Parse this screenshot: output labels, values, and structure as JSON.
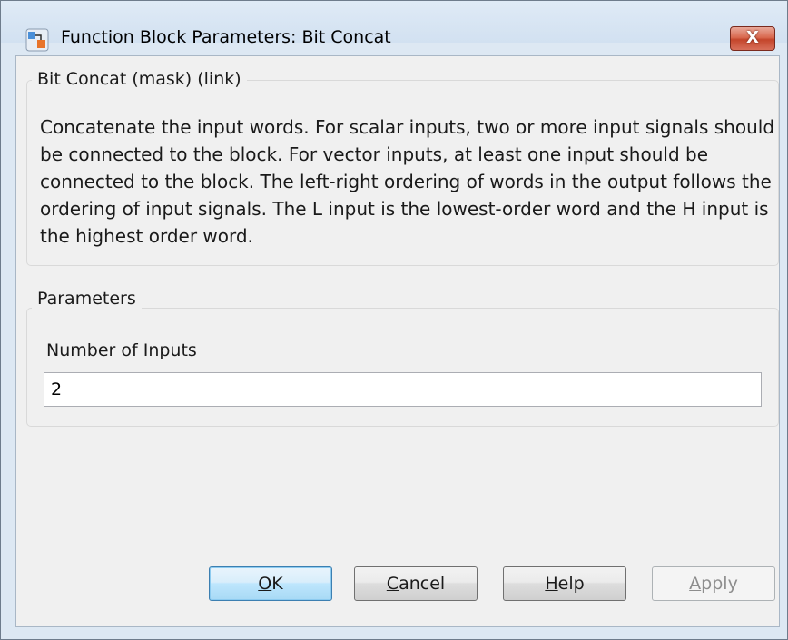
{
  "window": {
    "title": "Function Block Parameters: Bit Concat",
    "app_icon": "simulink-block-icon",
    "close_label": "X"
  },
  "mask_group": {
    "legend": "Bit Concat (mask) (link)",
    "description": "Concatenate the input words. For scalar inputs, two or more input signals should be connected to the block. For vector inputs, at least one input should be connected to the block.  The left-right ordering of words in the output follows the ordering of input signals. The L input is the lowest-order word and the H input is the highest order word."
  },
  "parameters_group": {
    "legend": "Parameters",
    "fields": [
      {
        "label": "Number of Inputs",
        "value": "2"
      }
    ]
  },
  "buttons": {
    "ok": {
      "mnemonic": "O",
      "rest": "K"
    },
    "cancel": {
      "mnemonic": "C",
      "rest": "ancel"
    },
    "help": {
      "mnemonic": "H",
      "rest": "elp"
    },
    "apply": {
      "mnemonic": "A",
      "rest": "pply",
      "enabled": false
    }
  }
}
